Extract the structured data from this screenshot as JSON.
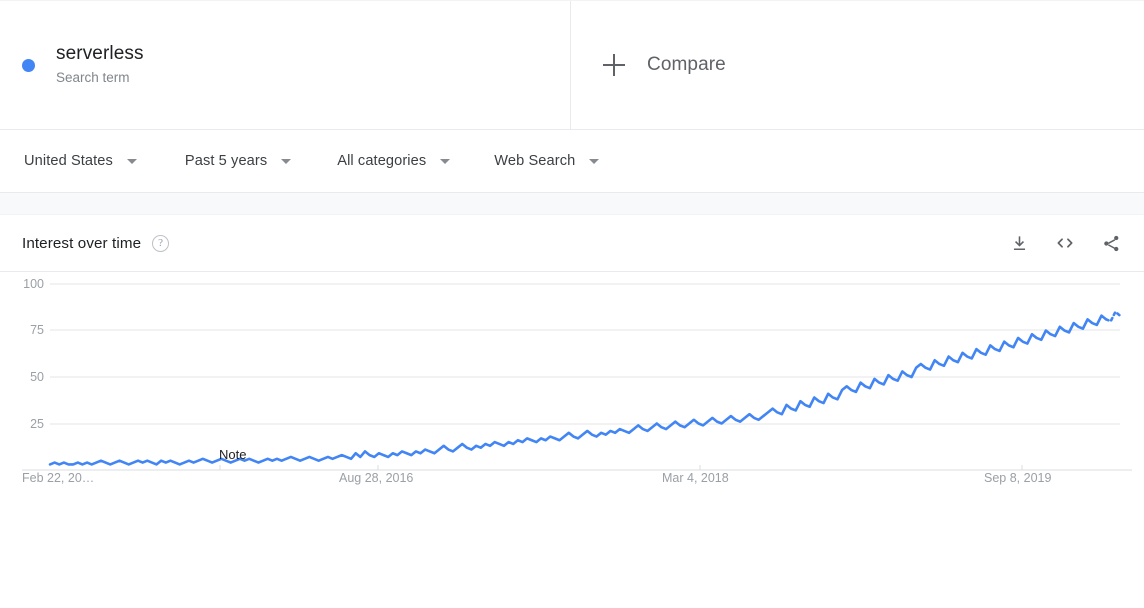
{
  "term": {
    "name": "serverless",
    "type_label": "Search term",
    "dot_color": "#4285f4"
  },
  "compare": {
    "label": "Compare",
    "icon": "plus-icon"
  },
  "filters": [
    {
      "label": "United States",
      "icon": "chevron-down-icon"
    },
    {
      "label": "Past 5 years",
      "icon": "chevron-down-icon"
    },
    {
      "label": "All categories",
      "icon": "chevron-down-icon"
    },
    {
      "label": "Web Search",
      "icon": "chevron-down-icon"
    }
  ],
  "card": {
    "title": "Interest over time",
    "help_icon": "help-circle-icon",
    "actions": [
      {
        "name": "download-icon",
        "tooltip": "Download"
      },
      {
        "name": "embed-code-icon",
        "tooltip": "Embed"
      },
      {
        "name": "share-icon",
        "tooltip": "Share"
      }
    ]
  },
  "chart_data": {
    "type": "line",
    "title": "Interest over time",
    "xlabel": "",
    "ylabel": "",
    "ylim": [
      0,
      100
    ],
    "grid": true,
    "legend": "none",
    "accent_color": "#4285f4",
    "y_ticks": [
      100,
      75,
      50,
      25
    ],
    "x_ticks": [
      {
        "label": "Feb 22, 20…",
        "index": 0
      },
      {
        "label": "Aug 28, 2016",
        "index": 79
      },
      {
        "label": "Mar 4, 2018",
        "index": 158
      },
      {
        "label": "Sep 8, 2019",
        "index": 237
      }
    ],
    "annotations": [
      {
        "text": "Note",
        "index": 68,
        "value": 10
      }
    ],
    "series": [
      {
        "name": "serverless",
        "color": "#4285f4",
        "partial_tail": 3,
        "values": [
          2,
          3,
          2,
          3,
          2,
          2,
          3,
          3,
          2,
          3,
          2,
          3,
          3,
          4,
          3,
          3,
          4,
          3,
          4,
          4,
          3,
          4,
          3,
          4,
          5,
          4,
          4,
          3,
          4,
          4,
          3,
          4,
          5,
          4,
          4,
          3,
          4,
          5,
          4,
          4,
          5,
          4,
          5,
          4,
          5,
          4,
          5,
          5,
          4,
          5,
          4,
          5,
          5,
          4,
          5,
          6,
          5,
          5,
          4,
          5,
          6,
          5,
          6,
          5,
          6,
          5,
          6,
          7,
          6,
          7,
          6,
          7,
          6,
          7,
          8,
          7,
          8,
          7,
          8,
          7,
          9,
          8,
          10,
          9,
          11,
          10,
          12,
          11,
          10,
          12,
          11,
          13,
          11,
          12,
          10,
          11,
          12,
          11,
          13,
          12,
          11,
          13,
          12,
          14,
          13,
          12,
          14,
          13,
          12,
          14,
          13,
          15,
          14,
          16,
          15,
          17,
          16,
          18,
          17,
          16,
          18,
          17,
          19,
          18,
          20,
          19,
          21,
          20,
          19,
          21,
          20,
          22,
          21,
          23,
          22,
          21,
          23,
          25,
          24,
          22,
          26,
          24,
          27,
          25,
          28,
          26,
          27,
          25,
          26,
          28,
          27,
          29,
          28,
          30,
          29,
          31,
          30,
          28,
          31,
          30,
          32,
          31,
          33,
          30,
          34,
          32,
          35,
          33,
          36,
          34,
          37,
          35,
          34,
          36,
          38,
          36,
          39,
          37,
          40,
          38,
          41,
          39,
          42,
          40,
          43,
          41,
          44,
          42,
          45,
          43,
          46,
          44,
          47,
          45,
          46,
          48,
          47,
          49,
          48,
          50,
          49,
          51,
          50,
          52,
          51,
          53,
          52,
          54,
          53,
          55,
          54,
          56,
          55,
          57,
          56,
          58,
          57,
          59,
          58,
          60,
          59,
          61,
          60,
          62,
          61,
          63,
          62,
          64,
          63,
          65,
          64,
          66,
          65,
          67,
          66,
          68,
          67,
          69,
          68,
          70,
          69,
          71,
          70,
          72
        ],
        "visual_points": [
          3,
          4,
          3,
          4,
          3,
          3,
          4,
          3,
          4,
          3,
          4,
          5,
          4,
          3,
          4,
          5,
          4,
          3,
          4,
          5,
          4,
          5,
          4,
          3,
          5,
          4,
          5,
          4,
          3,
          4,
          5,
          4,
          5,
          6,
          5,
          4,
          5,
          6,
          5,
          4,
          5,
          6,
          5,
          6,
          5,
          4,
          5,
          6,
          5,
          6,
          5,
          6,
          7,
          6,
          5,
          6,
          7,
          6,
          5,
          6,
          7,
          6,
          7,
          8,
          7,
          6,
          9,
          7,
          10,
          8,
          7,
          9,
          8,
          7,
          9,
          8,
          10,
          9,
          8,
          10,
          9,
          11,
          10,
          9,
          11,
          13,
          11,
          10,
          12,
          14,
          12,
          11,
          13,
          12,
          14,
          13,
          15,
          14,
          13,
          15,
          14,
          16,
          15,
          17,
          16,
          15,
          17,
          16,
          18,
          17,
          16,
          18,
          20,
          18,
          17,
          19,
          21,
          19,
          18,
          20,
          19,
          21,
          20,
          22,
          21,
          20,
          22,
          24,
          22,
          21,
          23,
          25,
          23,
          22,
          24,
          26,
          24,
          23,
          25,
          27,
          25,
          24,
          26,
          28,
          26,
          25,
          27,
          29,
          27,
          26,
          28,
          30,
          28,
          27,
          29,
          31,
          33,
          31,
          30,
          35,
          33,
          32,
          37,
          35,
          34,
          39,
          37,
          36,
          41,
          39,
          38,
          43,
          45,
          43,
          42,
          47,
          45,
          44,
          49,
          47,
          46,
          51,
          49,
          48,
          53,
          51,
          50,
          55,
          57,
          55,
          54,
          59,
          57,
          56,
          61,
          59,
          58,
          63,
          61,
          60,
          65,
          63,
          62,
          67,
          65,
          64,
          69,
          67,
          66,
          71,
          69,
          68,
          73,
          71,
          70,
          75,
          73,
          72,
          77,
          75,
          74,
          79,
          77,
          76,
          81,
          79,
          78,
          83,
          81,
          80,
          85,
          83
        ]
      }
    ]
  }
}
